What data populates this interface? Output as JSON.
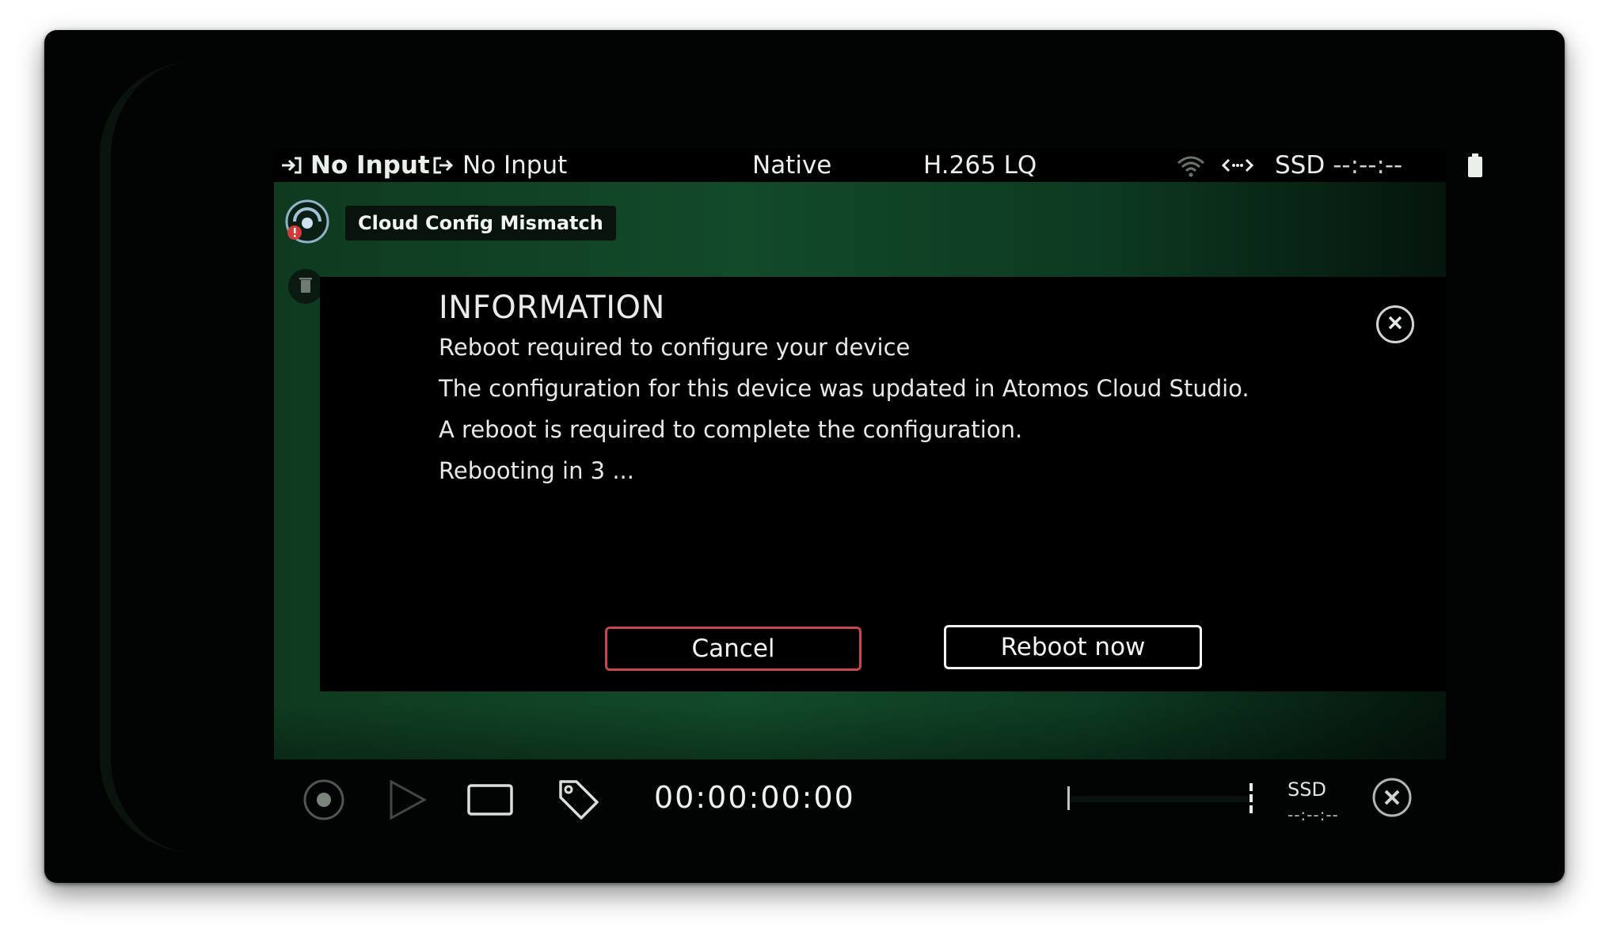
{
  "status_bar": {
    "input_label": "No Input",
    "output_label": "No Input",
    "mode": "Native",
    "codec": "H.265 LQ",
    "ssd_label": "SSD",
    "ssd_time": "--:--:--"
  },
  "cloud": {
    "badge": "Cloud Config Mismatch"
  },
  "dialog": {
    "title": "INFORMATION",
    "lines": [
      "Reboot required to configure your device",
      "The configuration for this device was updated in Atomos Cloud Studio.",
      "A reboot is required to complete the configuration.",
      "Rebooting in 3 ..."
    ],
    "cancel_label": "Cancel",
    "reboot_label": "Reboot now"
  },
  "bottom_bar": {
    "timecode": "00:00:00:00",
    "ssd_label": "SSD",
    "ssd_time": "--:--:--"
  },
  "colors": {
    "accent_green": "#124a2a",
    "cancel_border": "#c9474a",
    "text": "#e9efe9"
  },
  "icons": {
    "input": "input-arrow-icon",
    "output": "output-arrow-icon",
    "wifi": "wifi-icon",
    "link": "link-arrows-icon",
    "battery": "battery-icon",
    "cloud": "cloud-sync-icon",
    "close": "close-icon",
    "record": "record-icon",
    "play": "play-icon",
    "frame": "frame-icon",
    "tag": "tag-icon"
  }
}
